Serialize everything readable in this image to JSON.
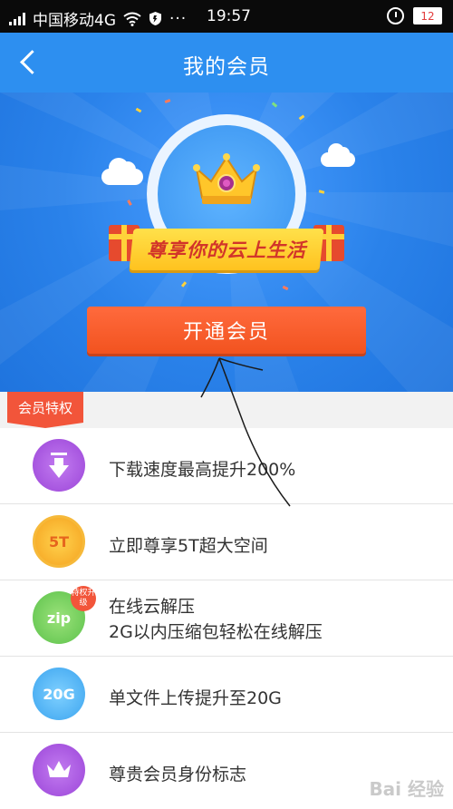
{
  "status_bar": {
    "carrier": "中国移动4G",
    "time": "19:57",
    "battery": "12",
    "icons": [
      "signal-icon",
      "wifi-icon",
      "shield-icon",
      "more-dots-icon",
      "alarm-icon",
      "battery-icon"
    ]
  },
  "header": {
    "title": "我的会员",
    "back_icon": "chevron-left-icon"
  },
  "hero": {
    "slogan": "尊享你的云上生活",
    "badge_icon": "crown-icon",
    "cta_label": "开通会员"
  },
  "perks": {
    "section_label": "会员特权",
    "items": [
      {
        "icon": "download-speed-icon",
        "text": "下载速度最高提升200%"
      },
      {
        "icon": "storage-5t-icon",
        "icon_text": "5T",
        "text": "立即尊享5T超大空间"
      },
      {
        "icon": "zip-icon",
        "icon_text": "zip",
        "badge": "特权升级",
        "text": "在线云解压",
        "subtext": "2G以内压缩包轻松在线解压"
      },
      {
        "icon": "upload-20g-icon",
        "icon_text": "20G",
        "text": "单文件上传提升至20G"
      },
      {
        "icon": "member-crown-icon",
        "text": "尊贵会员身份标志"
      }
    ]
  },
  "watermark": "Bai 经验",
  "colors": {
    "status_bar": "#0a0a0a",
    "header": "#2d8ff0",
    "hero_blue": "#2a82ea",
    "cta_orange": "#f2531f",
    "perk_tag": "#f2553a"
  }
}
